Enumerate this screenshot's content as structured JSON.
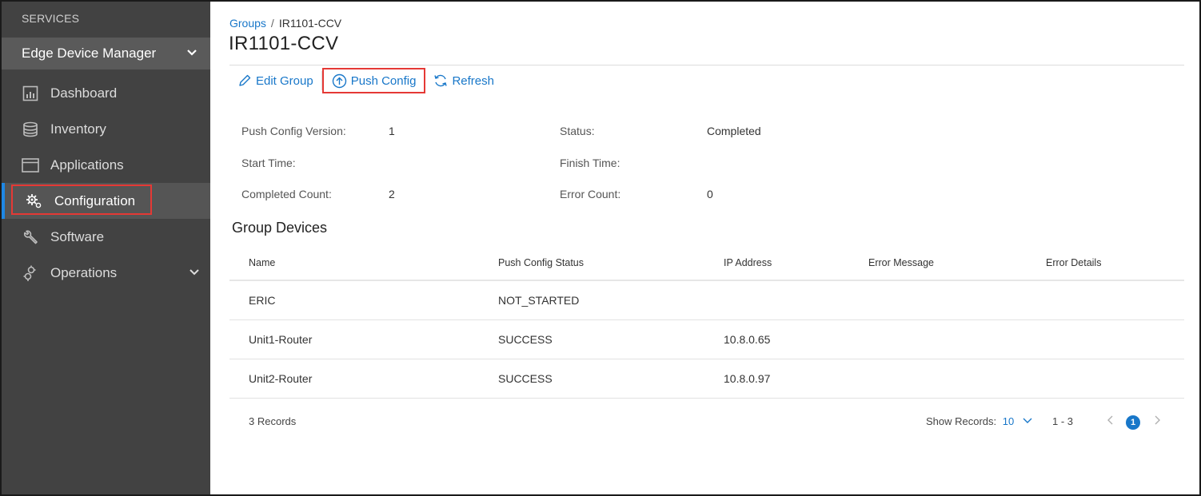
{
  "sidebar": {
    "section_label": "SERVICES",
    "app_name": "Edge Device Manager",
    "items": [
      {
        "label": "Dashboard"
      },
      {
        "label": "Inventory"
      },
      {
        "label": "Applications"
      },
      {
        "label": "Configuration"
      },
      {
        "label": "Software"
      },
      {
        "label": "Operations"
      }
    ]
  },
  "breadcrumb": {
    "parent": "Groups",
    "separator": "/",
    "current": "IR1101-CCV"
  },
  "page_title": "IR1101-CCV",
  "actions": {
    "edit": "Edit Group",
    "push": "Push Config",
    "refresh": "Refresh"
  },
  "details": {
    "push_version_label": "Push Config Version:",
    "push_version_value": "1",
    "status_label": "Status:",
    "status_value": "Completed",
    "start_label": "Start Time:",
    "start_value": "",
    "finish_label": "Finish Time:",
    "finish_value": "",
    "completed_label": "Completed Count:",
    "completed_value": "2",
    "error_label": "Error Count:",
    "error_value": "0"
  },
  "group_devices": {
    "title": "Group Devices",
    "columns": [
      "Name",
      "Push Config Status",
      "IP Address",
      "Error Message",
      "Error Details"
    ],
    "rows": [
      {
        "name": "ERIC",
        "status": "NOT_STARTED",
        "ip": "",
        "error_message": "",
        "error_details": ""
      },
      {
        "name": "Unit1-Router",
        "status": "SUCCESS",
        "ip": "10.8.0.65",
        "error_message": "",
        "error_details": ""
      },
      {
        "name": "Unit2-Router",
        "status": "SUCCESS",
        "ip": "10.8.0.97",
        "error_message": "",
        "error_details": ""
      }
    ]
  },
  "footer": {
    "records": "3 Records",
    "show_records_label": "Show Records:",
    "show_records_value": "10",
    "range": "1 - 3",
    "current_page": "1"
  },
  "colors": {
    "accent": "#1877c9",
    "highlight": "#e53935",
    "sidebar_bg": "#424242"
  }
}
